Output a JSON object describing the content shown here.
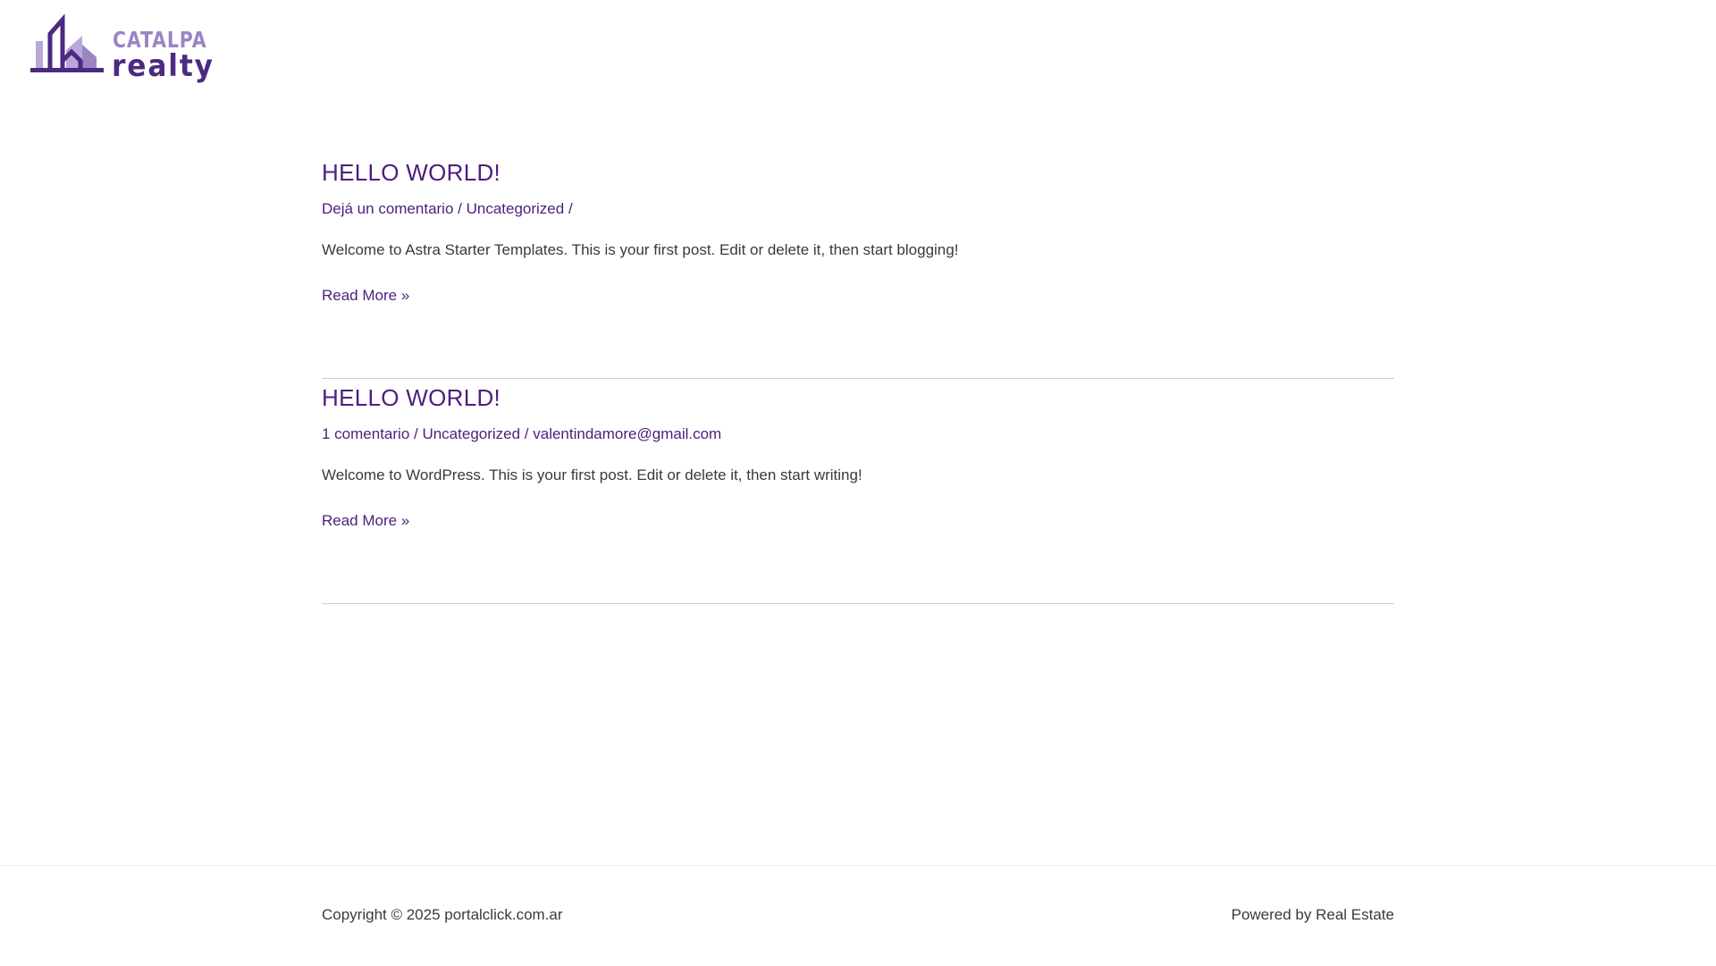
{
  "header": {
    "logo": {
      "top_word": "CATALPA",
      "bottom_word": "realty",
      "colors": {
        "light_purple": "#9b84c4",
        "dark_purple": "#4b2a82"
      }
    }
  },
  "posts": [
    {
      "title": "HELLO WORLD!",
      "meta": {
        "comments": "Dejá un comentario",
        "separator1": " / ",
        "category": "Uncategorized",
        "separator2": " /",
        "author": ""
      },
      "excerpt": "Welcome to Astra Starter Templates. This is your first post. Edit or delete it, then start blogging!",
      "read_more": "Read More »"
    },
    {
      "title": "HELLO WORLD!",
      "meta": {
        "comments": "1 comentario",
        "separator1": " / ",
        "category": "Uncategorized",
        "separator2": " / ",
        "author": "valentindamore@gmail.com"
      },
      "excerpt": "Welcome to WordPress. This is your first post. Edit or delete it, then start writing!",
      "read_more": "Read More »"
    }
  ],
  "footer": {
    "copyright": "Copyright © 2025 portalclick.com.ar",
    "powered_by": "Powered by Real Estate"
  },
  "theme": {
    "accent": "#4b1f7e",
    "text": "#3a3a3a",
    "divider": "#e2c6b6"
  }
}
